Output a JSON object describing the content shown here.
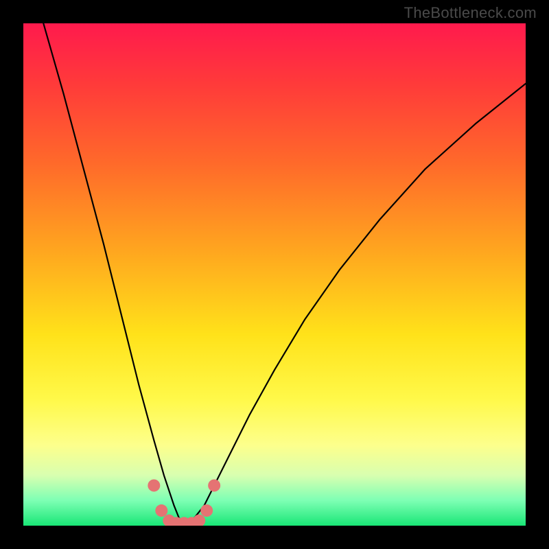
{
  "watermark": "TheBottleneck.com",
  "chart_data": {
    "type": "line",
    "title": "",
    "xlabel": "",
    "ylabel": "",
    "xlim": [
      0,
      100
    ],
    "ylim": [
      0,
      100
    ],
    "grid": false,
    "note": "No axis ticks or labels are rendered; values are implied positions (0–100 in each direction). The curve descends steeply from the top-left, reaches a minimum near x≈32 at y≈0, then rises with decreasing slope toward the upper right. A short row of pink markers sits at the trough along the x-axis.",
    "series": [
      {
        "name": "curve",
        "color": "#000000",
        "x": [
          4,
          8,
          12,
          16,
          20,
          23,
          26,
          28,
          30,
          31,
          32,
          33,
          34,
          36,
          38,
          41,
          45,
          50,
          56,
          63,
          71,
          80,
          90,
          100
        ],
        "y": [
          100,
          86,
          71,
          56,
          40,
          28,
          17,
          10,
          4,
          1.5,
          0.5,
          0.5,
          1.5,
          4,
          8,
          14,
          22,
          31,
          41,
          51,
          61,
          71,
          80,
          88
        ]
      },
      {
        "name": "trough-markers",
        "color": "#e57373",
        "marker": "circle",
        "x": [
          26,
          27.5,
          29,
          30.5,
          32,
          33.5,
          35,
          36.5,
          38
        ],
        "y": [
          8,
          3,
          1,
          0.5,
          0.5,
          0.5,
          1,
          3,
          8
        ]
      }
    ]
  }
}
